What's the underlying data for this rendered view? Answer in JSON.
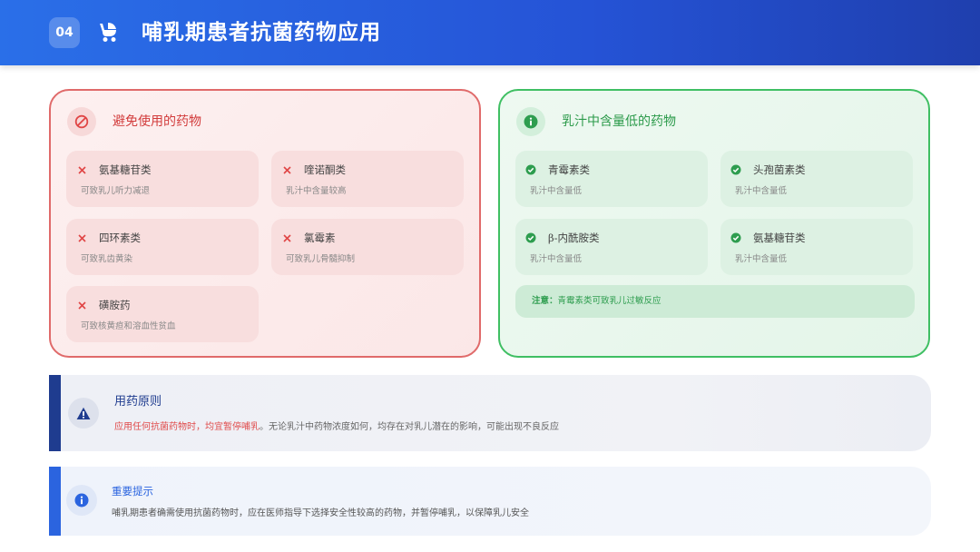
{
  "header": {
    "badge": "04",
    "title": "哺乳期患者抗菌药物应用",
    "icon": "stroller-icon"
  },
  "avoid_panel": {
    "title": "避免使用的药物",
    "icon": "prohibited-icon",
    "accent": "#e06a6a",
    "items": [
      {
        "name": "氨基糖苷类",
        "desc": "可致乳儿听力减退"
      },
      {
        "name": "喹诺酮类",
        "desc": "乳汁中含量较高"
      },
      {
        "name": "四环素类",
        "desc": "可致乳齿黄染"
      },
      {
        "name": "氯霉素",
        "desc": "可致乳儿骨髓抑制"
      },
      {
        "name": "磺胺药",
        "desc": "可致核黄疸和溶血性贫血"
      }
    ]
  },
  "low_panel": {
    "title": "乳汁中含量低的药物",
    "icon": "info-icon",
    "accent": "#3fbf63",
    "items": [
      {
        "name": "青霉素类",
        "desc": "乳汁中含量低"
      },
      {
        "name": "头孢菌素类",
        "desc": "乳汁中含量低"
      },
      {
        "name": "β-内酰胺类",
        "desc": "乳汁中含量低"
      },
      {
        "name": "氨基糖苷类",
        "desc": "乳汁中含量低"
      }
    ],
    "note_label": "注意：",
    "note_text": "青霉素类可致乳儿过敏反应"
  },
  "principle": {
    "title": "用药原则",
    "icon": "warning-icon",
    "highlight": "应用任何抗菌药物时，均宜暂停哺乳",
    "text": "。无论乳汁中药物浓度如何，均存在对乳儿潜在的影响，可能出现不良反应"
  },
  "tip": {
    "title": "重要提示",
    "icon": "info-circle-icon",
    "text": "哺乳期患者确需使用抗菌药物时，应在医师指导下选择安全性较高的药物，并暂停哺乳，以保障乳儿安全"
  }
}
